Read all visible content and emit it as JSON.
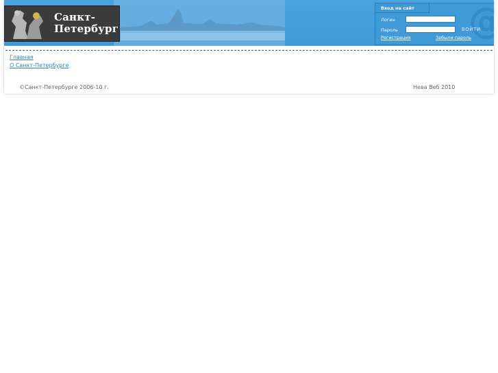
{
  "header": {
    "logo_line1": "Санкт-",
    "logo_line2": "Петербург"
  },
  "login": {
    "tab_label": "Вход на сайт",
    "login_label": "Логин",
    "password_label": "Пароль",
    "login_value": "",
    "password_value": "",
    "submit_label": "ВОЙТИ",
    "register_link": "Регистрация",
    "forgot_link": "Забыли пароль",
    "at_symbol": "@"
  },
  "nav": {
    "home": "Главная",
    "about": "О Санкт-Петербурге"
  },
  "footer": {
    "copyright": "©Санкт-Петербурге 2006-10 г.",
    "credit": "Нева Веб 2010"
  },
  "colors": {
    "header_blue": "#4aa3df",
    "link_blue": "#2f86c4"
  }
}
